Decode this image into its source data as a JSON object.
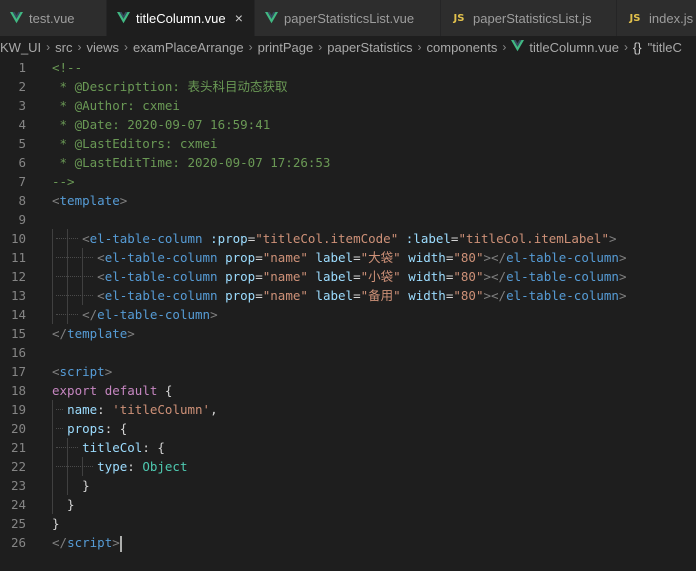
{
  "tabs": [
    {
      "label": "test.vue",
      "icon": "vue-icon",
      "state": "modified",
      "active": false
    },
    {
      "label": "titleColumn.vue",
      "icon": "vue-icon",
      "state": "close",
      "active": true
    },
    {
      "label": "paperStatisticsList.vue",
      "icon": "vue-icon",
      "state": "none",
      "active": false
    },
    {
      "label": "paperStatisticsList.js",
      "icon": "js-icon",
      "state": "none",
      "active": false
    },
    {
      "label": "index.js",
      "icon": "js-icon",
      "state": "none",
      "active": false
    }
  ],
  "js_badge": "JS",
  "close_glyph": "×",
  "breadcrumbs": [
    "KW_UI",
    "src",
    "views",
    "examPlaceArrange",
    "printPage",
    "paperStatistics",
    "components",
    "titleColumn.vue"
  ],
  "breadcrumb_symbol": "{}",
  "breadcrumb_symbol_label": "\"titleC",
  "colors": {
    "vue": "#41b883",
    "js": "#e2c14c",
    "background": "#1e1e1e",
    "line_number": "#858585"
  },
  "lines": [
    {
      "n": "1",
      "t": [
        [
          "c-com",
          "<!--"
        ]
      ]
    },
    {
      "n": "2",
      "t": [
        [
          "c-com",
          " * @Descripttion: 表头科目动态获取"
        ]
      ]
    },
    {
      "n": "3",
      "t": [
        [
          "c-com",
          " * @Author: cxmei"
        ]
      ]
    },
    {
      "n": "4",
      "t": [
        [
          "c-com",
          " * @Date: 2020-09-07 16:59:41"
        ]
      ]
    },
    {
      "n": "5",
      "t": [
        [
          "c-com",
          " * @LastEditors: cxmei"
        ]
      ]
    },
    {
      "n": "6",
      "t": [
        [
          "c-com",
          " * @LastEditTime: 2020-09-07 17:26:53"
        ]
      ]
    },
    {
      "n": "7",
      "t": [
        [
          "c-com",
          "-->"
        ]
      ]
    },
    {
      "n": "8",
      "t": [
        [
          "c-br",
          "<"
        ],
        [
          "c-tag",
          "template"
        ],
        [
          "c-br",
          ">"
        ]
      ]
    },
    {
      "n": "9",
      "t": []
    },
    {
      "n": "10",
      "t": [
        [
          "c-def",
          "    "
        ],
        [
          "c-br",
          "<"
        ],
        [
          "c-tag",
          "el-table-column"
        ],
        [
          "c-def",
          " "
        ],
        [
          "c-attr",
          ":prop"
        ],
        [
          "c-def",
          "="
        ],
        [
          "c-str",
          "\"titleCol.itemCode\""
        ],
        [
          "c-def",
          " "
        ],
        [
          "c-attr",
          ":label"
        ],
        [
          "c-def",
          "="
        ],
        [
          "c-str",
          "\"titleCol.itemLabel\""
        ],
        [
          "c-br",
          ">"
        ]
      ]
    },
    {
      "n": "11",
      "t": [
        [
          "c-def",
          "      "
        ],
        [
          "c-br",
          "<"
        ],
        [
          "c-tag",
          "el-table-column"
        ],
        [
          "c-def",
          " "
        ],
        [
          "c-attr",
          "prop"
        ],
        [
          "c-def",
          "="
        ],
        [
          "c-str",
          "\"name\""
        ],
        [
          "c-def",
          " "
        ],
        [
          "c-attr",
          "label"
        ],
        [
          "c-def",
          "="
        ],
        [
          "c-str",
          "\"大袋\""
        ],
        [
          "c-def",
          " "
        ],
        [
          "c-attr",
          "width"
        ],
        [
          "c-def",
          "="
        ],
        [
          "c-str",
          "\"80\""
        ],
        [
          "c-br",
          "></"
        ],
        [
          "c-tag",
          "el-table-column"
        ],
        [
          "c-br",
          ">"
        ]
      ]
    },
    {
      "n": "12",
      "t": [
        [
          "c-def",
          "      "
        ],
        [
          "c-br",
          "<"
        ],
        [
          "c-tag",
          "el-table-column"
        ],
        [
          "c-def",
          " "
        ],
        [
          "c-attr",
          "prop"
        ],
        [
          "c-def",
          "="
        ],
        [
          "c-str",
          "\"name\""
        ],
        [
          "c-def",
          " "
        ],
        [
          "c-attr",
          "label"
        ],
        [
          "c-def",
          "="
        ],
        [
          "c-str",
          "\"小袋\""
        ],
        [
          "c-def",
          " "
        ],
        [
          "c-attr",
          "width"
        ],
        [
          "c-def",
          "="
        ],
        [
          "c-str",
          "\"80\""
        ],
        [
          "c-br",
          "></"
        ],
        [
          "c-tag",
          "el-table-column"
        ],
        [
          "c-br",
          ">"
        ]
      ]
    },
    {
      "n": "13",
      "t": [
        [
          "c-def",
          "      "
        ],
        [
          "c-br",
          "<"
        ],
        [
          "c-tag",
          "el-table-column"
        ],
        [
          "c-def",
          " "
        ],
        [
          "c-attr",
          "prop"
        ],
        [
          "c-def",
          "="
        ],
        [
          "c-str",
          "\"name\""
        ],
        [
          "c-def",
          " "
        ],
        [
          "c-attr",
          "label"
        ],
        [
          "c-def",
          "="
        ],
        [
          "c-str",
          "\"备用\""
        ],
        [
          "c-def",
          " "
        ],
        [
          "c-attr",
          "width"
        ],
        [
          "c-def",
          "="
        ],
        [
          "c-str",
          "\"80\""
        ],
        [
          "c-br",
          "></"
        ],
        [
          "c-tag",
          "el-table-column"
        ],
        [
          "c-br",
          ">"
        ]
      ]
    },
    {
      "n": "14",
      "t": [
        [
          "c-def",
          "    "
        ],
        [
          "c-br",
          "</"
        ],
        [
          "c-tag",
          "el-table-column"
        ],
        [
          "c-br",
          ">"
        ]
      ]
    },
    {
      "n": "15",
      "t": [
        [
          "c-br",
          "</"
        ],
        [
          "c-tag",
          "template"
        ],
        [
          "c-br",
          ">"
        ]
      ]
    },
    {
      "n": "16",
      "t": []
    },
    {
      "n": "17",
      "t": [
        [
          "c-br",
          "<"
        ],
        [
          "c-tag",
          "script"
        ],
        [
          "c-br",
          ">"
        ]
      ]
    },
    {
      "n": "18",
      "t": [
        [
          "c-kw",
          "export"
        ],
        [
          "c-def",
          " "
        ],
        [
          "c-kw",
          "default"
        ],
        [
          "c-def",
          " {"
        ]
      ]
    },
    {
      "n": "19",
      "t": [
        [
          "c-def",
          "  "
        ],
        [
          "c-attr",
          "name"
        ],
        [
          "c-def",
          ": "
        ],
        [
          "c-str",
          "'titleColumn'"
        ],
        [
          "c-def",
          ","
        ]
      ]
    },
    {
      "n": "20",
      "t": [
        [
          "c-def",
          "  "
        ],
        [
          "c-attr",
          "props"
        ],
        [
          "c-def",
          ": {"
        ]
      ]
    },
    {
      "n": "21",
      "t": [
        [
          "c-def",
          "    "
        ],
        [
          "c-attr",
          "titleCol"
        ],
        [
          "c-def",
          ": {"
        ]
      ]
    },
    {
      "n": "22",
      "t": [
        [
          "c-def",
          "      "
        ],
        [
          "c-attr",
          "type"
        ],
        [
          "c-def",
          ": "
        ],
        [
          "c-fn",
          "Object"
        ]
      ]
    },
    {
      "n": "23",
      "t": [
        [
          "c-def",
          "    }"
        ]
      ]
    },
    {
      "n": "24",
      "t": [
        [
          "c-def",
          "  }"
        ]
      ]
    },
    {
      "n": "25",
      "t": [
        [
          "c-def",
          "}"
        ]
      ]
    },
    {
      "n": "26",
      "t": [
        [
          "c-br",
          "</"
        ],
        [
          "c-tag",
          "script"
        ],
        [
          "c-br",
          ">"
        ]
      ]
    }
  ]
}
